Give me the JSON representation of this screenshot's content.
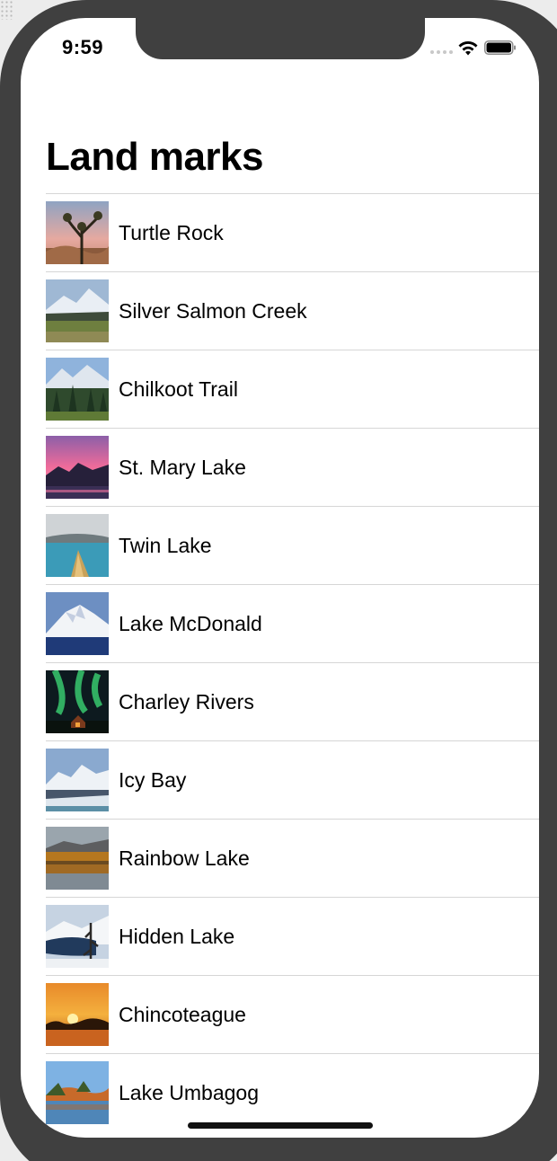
{
  "status_bar": {
    "time": "9:59",
    "signal_icon": "cellular-dots-icon",
    "wifi_icon": "wifi-icon",
    "battery_icon": "battery-icon"
  },
  "nav": {
    "title": "Land marks"
  },
  "landmarks": [
    {
      "name": "Turtle Rock",
      "thumbnail": "joshua-tree-desert-photo"
    },
    {
      "name": "Silver Salmon Creek",
      "thumbnail": "snowy-mountain-meadow-photo"
    },
    {
      "name": "Chilkoot Trail",
      "thumbnail": "forest-mountain-photo"
    },
    {
      "name": "St. Mary Lake",
      "thumbnail": "pink-sunset-lake-photo"
    },
    {
      "name": "Twin Lake",
      "thumbnail": "canoe-on-blue-lake-photo"
    },
    {
      "name": "Lake McDonald",
      "thumbnail": "snow-peak-lake-photo"
    },
    {
      "name": "Charley Rivers",
      "thumbnail": "northern-lights-cabin-photo"
    },
    {
      "name": "Icy Bay",
      "thumbnail": "glacier-mountain-photo"
    },
    {
      "name": "Rainbow Lake",
      "thumbnail": "autumn-lake-reflection-photo"
    },
    {
      "name": "Hidden Lake",
      "thumbnail": "winter-lake-tree-photo"
    },
    {
      "name": "Chincoteague",
      "thumbnail": "orange-sunset-marsh-photo"
    },
    {
      "name": "Lake Umbagog",
      "thumbnail": "autumn-lakeshore-photo"
    }
  ]
}
